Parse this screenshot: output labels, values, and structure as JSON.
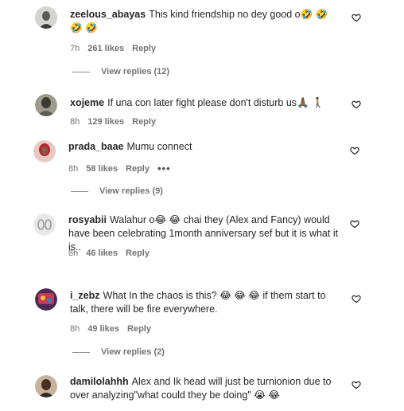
{
  "comments": [
    {
      "username": "zeelous_abayas",
      "text": "This kind friendship no dey good o🤣 🤣 🤣 🤣",
      "time": "7h",
      "likes": "261 likes",
      "reply_label": "Reply",
      "view_replies": "View replies (12)",
      "avatar_color": "#b9bdb6"
    },
    {
      "username": "xojeme",
      "text": "If una con later fight please don't disturb us🙏🏾 🚶🏾",
      "time": "8h",
      "likes": "129 likes",
      "reply_label": "Reply",
      "avatar_color": "#7d7a6f"
    },
    {
      "username": "prada_baae",
      "text": "Mumu connect",
      "time": "8h",
      "likes": "58 likes",
      "reply_label": "Reply",
      "more": "•••",
      "view_replies": "View replies (9)",
      "avatar_color": "#c0393b"
    },
    {
      "username": "rosyabii",
      "text": "Walahur o😂 😂 chai they (Alex and Fancy) would have been celebrating 1month anniversary sef but it is what it is..",
      "time": "8h",
      "likes": "46 likes",
      "reply_label": "Reply",
      "avatar_color": "#d9d9d9"
    },
    {
      "username": "i_zebz",
      "text": "What In the chaos is this? 😂 😂 😂 if them start to talk, there will be fire everywhere.",
      "time": "8h",
      "likes": "49 likes",
      "reply_label": "Reply",
      "view_replies": "View replies (2)",
      "avatar_color": "#7a2b4b"
    },
    {
      "username": "damilolahhh",
      "text": "Alex and Ik head will just be turnionion due to over analyzing\"what could they be doing\" 😭 😂",
      "avatar_color": "#5a3d2e"
    }
  ]
}
